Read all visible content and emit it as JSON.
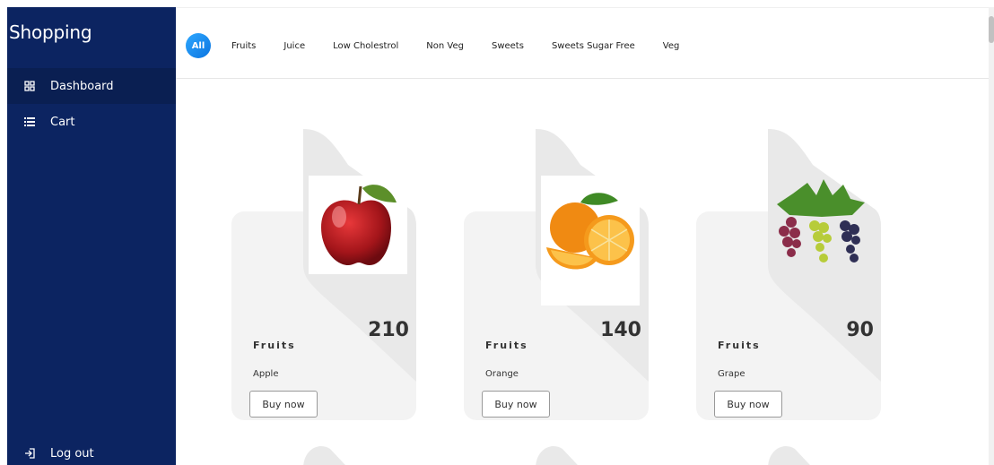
{
  "sidebar": {
    "brand": "Shopping",
    "items": [
      {
        "label": "Dashboard",
        "icon": "grid-icon"
      },
      {
        "label": "Cart",
        "icon": "list-icon"
      }
    ],
    "logout": {
      "label": "Log out",
      "icon": "logout-icon"
    }
  },
  "topbar": {
    "tabs": [
      "All",
      "Fruits",
      "Juice",
      "Low Cholestrol",
      "Non Veg",
      "Sweets",
      "Sweets Sugar Free",
      "Veg"
    ],
    "active_tab": "All"
  },
  "products": [
    {
      "category": "Fruits",
      "name": "Apple",
      "price": "210",
      "button": "Buy now",
      "image": "apple"
    },
    {
      "category": "Fruits",
      "name": "Orange",
      "price": "140",
      "button": "Buy now",
      "image": "orange"
    },
    {
      "category": "Fruits",
      "name": "Grape",
      "price": "90",
      "button": "Buy now",
      "image": "grape"
    }
  ],
  "colors": {
    "sidebar": "#0c2461",
    "accent": "#1a8cf0",
    "card": "#f3f3f3"
  }
}
